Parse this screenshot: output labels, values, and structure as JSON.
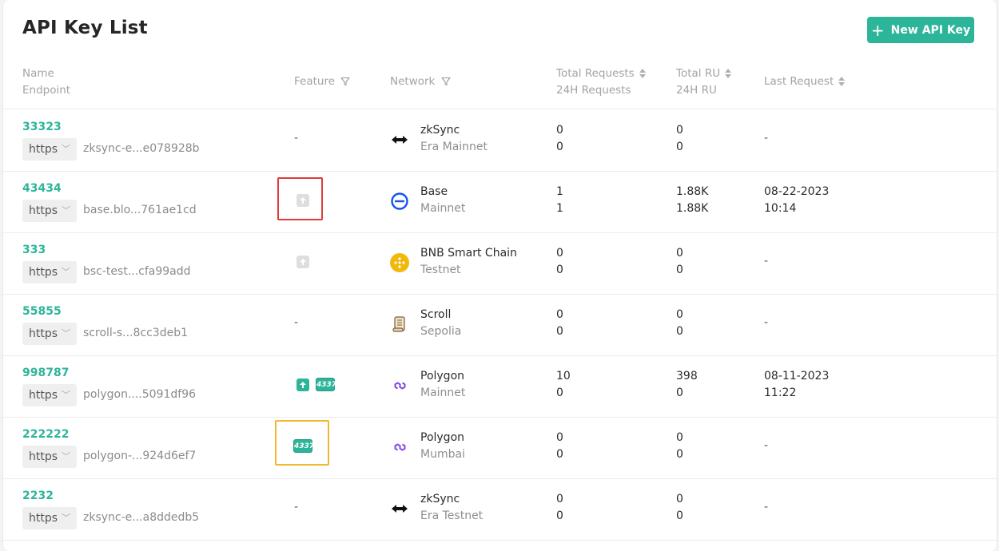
{
  "header": {
    "title": "API Key List",
    "new_button_label": "New API Key"
  },
  "columns": {
    "name": "Name",
    "endpoint": "Endpoint",
    "feature": "Feature",
    "network": "Network",
    "total_requests": "Total Requests",
    "h24_requests": "24H Requests",
    "total_ru": "Total RU",
    "h24_ru": "24H RU",
    "last_request": "Last Request"
  },
  "rows": [
    {
      "name": "33323",
      "protocol": "https",
      "endpoint": "zksync-e...e078928b",
      "feature": "-",
      "network": "zkSync",
      "network_sub": "Era Mainnet",
      "network_icon": "zksync-icon",
      "total_requests": "0",
      "requests_24h": "0",
      "total_ru": "0",
      "ru_24h": "0",
      "last_request": "-"
    },
    {
      "name": "43434",
      "protocol": "https",
      "endpoint": "base.blo...761ae1cd",
      "feature_icons": [
        "upload-feature-icon"
      ],
      "network": "Base",
      "network_sub": "Mainnet",
      "network_icon": "base-icon",
      "total_requests": "1",
      "requests_24h": "1",
      "total_ru": "1.88K",
      "ru_24h": "1.88K",
      "last_request_date": "08-22-2023",
      "last_request_time": "10:14"
    },
    {
      "name": "333",
      "protocol": "https",
      "endpoint": "bsc-test...cfa99add",
      "feature_icons": [
        "upload-feature-icon"
      ],
      "network": "BNB Smart Chain",
      "network_sub": "Testnet",
      "network_icon": "bnb-icon",
      "total_requests": "0",
      "requests_24h": "0",
      "total_ru": "0",
      "ru_24h": "0",
      "last_request": "-"
    },
    {
      "name": "55855",
      "protocol": "https",
      "endpoint": "scroll-s...8cc3deb1",
      "feature": "-",
      "network": "Scroll",
      "network_sub": "Sepolia",
      "network_icon": "scroll-icon",
      "total_requests": "0",
      "requests_24h": "0",
      "total_ru": "0",
      "ru_24h": "0",
      "last_request": "-"
    },
    {
      "name": "998787",
      "protocol": "https",
      "endpoint": "polygon....5091df96",
      "feature_icons": [
        "upload-feature-icon",
        "erc4337-badge"
      ],
      "badge_text": "4337",
      "network": "Polygon",
      "network_sub": "Mainnet",
      "network_icon": "polygon-icon",
      "total_requests": "10",
      "requests_24h": "0",
      "total_ru": "398",
      "ru_24h": "0",
      "last_request_date": "08-11-2023",
      "last_request_time": "11:22"
    },
    {
      "name": "222222",
      "protocol": "https",
      "endpoint": "polygon-...924d6ef7",
      "feature_icons": [
        "erc4337-badge"
      ],
      "badge_text": "4337",
      "network": "Polygon",
      "network_sub": "Mumbai",
      "network_icon": "polygon-icon",
      "total_requests": "0",
      "requests_24h": "0",
      "total_ru": "0",
      "ru_24h": "0",
      "last_request": "-"
    },
    {
      "name": "2232",
      "protocol": "https",
      "endpoint": "zksync-e...a8ddedb5",
      "feature": "-",
      "network": "zkSync",
      "network_sub": "Era Testnet",
      "network_icon": "zksync-icon",
      "total_requests": "0",
      "requests_24h": "0",
      "total_ru": "0",
      "ru_24h": "0",
      "last_request": "-"
    }
  ],
  "colors": {
    "accent": "#2db59a",
    "highlight_red": "#e03a3a",
    "highlight_yellow": "#f0b82c"
  }
}
